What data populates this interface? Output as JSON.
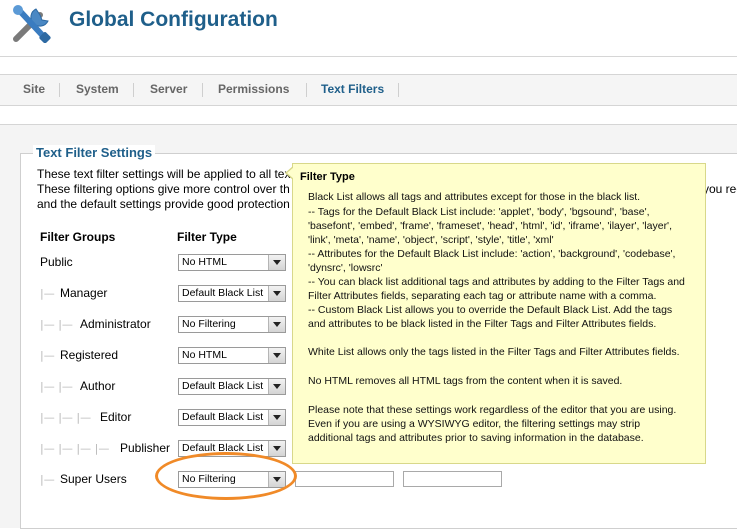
{
  "header": {
    "title": "Global Configuration",
    "logo_icon": "config-tools-icon"
  },
  "tabs": [
    {
      "label": "Site"
    },
    {
      "label": "System"
    },
    {
      "label": "Server"
    },
    {
      "label": "Permissions"
    },
    {
      "label": "Text Filters",
      "active": true
    }
  ],
  "settings": {
    "legend": "Text Filter Settings",
    "desc": [
      "These text filter settings will be applied to all tex",
      "These filtering options give more control over th",
      "and the default settings provide good protection"
    ],
    "desc_right_fragment": "you rec",
    "col_groups": "Filter Groups",
    "col_type": "Filter Type"
  },
  "groups": [
    {
      "tree": "",
      "label": "Public",
      "filter": "No HTML"
    },
    {
      "tree": "|—",
      "label": "Manager",
      "filter": "Default Black List"
    },
    {
      "tree": "|— |—",
      "label": "Administrator",
      "filter": "No Filtering"
    },
    {
      "tree": "|—",
      "label": "Registered",
      "filter": "No HTML"
    },
    {
      "tree": "|— |—",
      "label": "Author",
      "filter": "Default Black List"
    },
    {
      "tree": "|— |— |—",
      "label": "Editor",
      "filter": "Default Black List"
    },
    {
      "tree": "|— |— |— |—",
      "label": "Publisher",
      "filter": "Default Black List"
    },
    {
      "tree": "|—",
      "label": "Super Users",
      "filter": "No Filtering"
    }
  ],
  "tooltip": {
    "title": "Filter Type",
    "lines": [
      "Black List allows all tags and attributes except for those in the black list.",
      "-- Tags for the Default Black List include: 'applet', 'body', 'bgsound', 'base',",
      "'basefont', 'embed', 'frame', 'frameset', 'head', 'html', 'id', 'iframe', 'ilayer', 'layer',",
      "'link', 'meta', 'name', 'object', 'script', 'style', 'title', 'xml'",
      "-- Attributes for the Default Black List include: 'action', 'background', 'codebase',",
      "'dynsrc', 'lowsrc'",
      "-- You can black list additional tags and attributes by adding to the Filter Tags and",
      "Filter Attributes fields, separating each tag or attribute name with a comma.",
      "-- Custom Black List allows you to override the Default Black List. Add the tags",
      "and attributes to be black listed in the Filter Tags and Filter Attributes fields.",
      "",
      "White List allows only the tags listed in the Filter Tags and Filter Attributes fields.",
      "",
      "No HTML removes all HTML tags from the content when it is saved.",
      "",
      "Please note that these settings work regardless of the editor that you are using.",
      "Even if you are using a WYSIWYG editor, the filtering settings may strip",
      "additional tags and attributes prior to saving information in the database."
    ]
  },
  "colors": {
    "title": "#1f5f8a",
    "tooltip_bg": "#ffffcc",
    "highlight": "#f08a28"
  }
}
